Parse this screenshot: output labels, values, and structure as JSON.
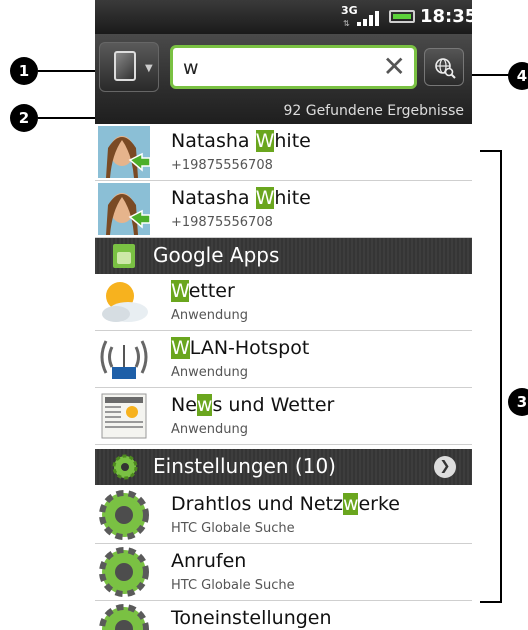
{
  "status_bar": {
    "network": "3G",
    "time": "18:35"
  },
  "search": {
    "query": "w",
    "results_count": "92 Gefundene Ergebnisse"
  },
  "callouts": [
    "1",
    "2",
    "3",
    "4"
  ],
  "contacts": [
    {
      "name_pre": "Natasha ",
      "name_hl": "W",
      "name_post": "hite",
      "phone": "+19875556708"
    },
    {
      "name_pre": "Natasha ",
      "name_hl": "W",
      "name_post": "hite",
      "phone": "+19875556708"
    }
  ],
  "sections": {
    "google_apps": {
      "label": "Google Apps"
    },
    "settings": {
      "label": "Einstellungen (10)"
    }
  },
  "apps": [
    {
      "pre": "",
      "hl": "W",
      "post": "etter",
      "sub": "Anwendung",
      "icon": "weather-icon"
    },
    {
      "pre": "",
      "hl": "W",
      "post": "LAN-Hotspot",
      "sub": "Anwendung",
      "icon": "wifi-hotspot-icon"
    },
    {
      "pre": "Ne",
      "hl": "w",
      "post": "s und Wetter",
      "sub": "Anwendung",
      "icon": "news-icon"
    }
  ],
  "settings_items": [
    {
      "pre": "Drahtlos und Netz",
      "hl": "w",
      "post": "erke",
      "sub": "HTC Globale Suche"
    },
    {
      "pre": "Anrufen",
      "hl": "",
      "post": "",
      "sub": "HTC Globale Suche"
    },
    {
      "pre": "Toneinstellungen",
      "hl": "",
      "post": "",
      "sub": ""
    }
  ],
  "colors": {
    "highlight": "#6aa61e",
    "search_border": "#7ac143"
  }
}
